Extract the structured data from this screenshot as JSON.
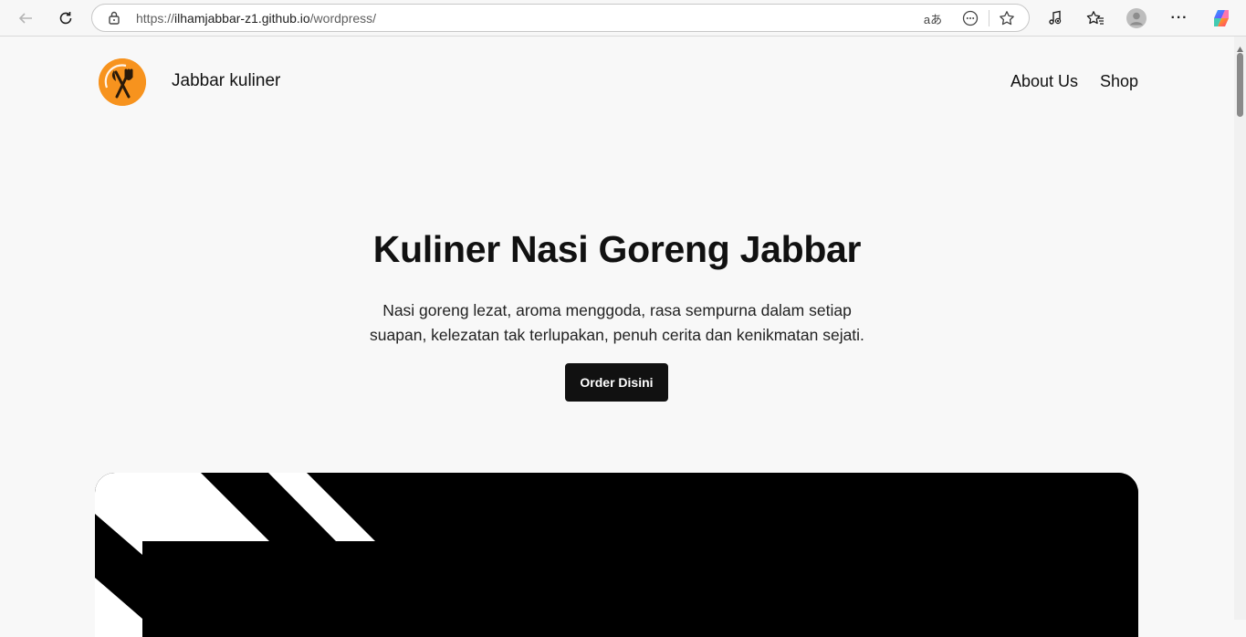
{
  "browser": {
    "url_scheme": "https://",
    "url_host": "ilhamjabbar-z1.github.io",
    "url_path": "/wordpress/",
    "icons": {
      "back": "back-arrow-icon",
      "reload": "reload-icon",
      "lock": "lock-icon",
      "read_aloud": "read-aloud-icon",
      "extension": "page-extension-icon",
      "favorite": "star-icon",
      "media": "media-control-icon",
      "favorites": "favorites-icon",
      "profile": "profile-avatar-icon",
      "menu": "more-menu-icon",
      "copilot": "copilot-icon"
    },
    "read_aloud_glyph": "aあ",
    "menu_glyph": "···"
  },
  "site": {
    "title": "Jabbar kuliner",
    "logo_color": "#f7931e"
  },
  "nav": {
    "items": [
      {
        "label": "About Us"
      },
      {
        "label": "Shop"
      }
    ]
  },
  "hero": {
    "title": "Kuliner Nasi Goreng Jabbar",
    "text": "Nasi goreng lezat, aroma menggoda, rasa sempurna dalam setiap suapan, kelezatan tak terlupakan, penuh cerita dan kenikmatan sejati.",
    "button_label": "Order Disini"
  },
  "colors": {
    "background": "#f8f8f8",
    "text": "#111111",
    "button": "#111111",
    "button_text": "#ffffff"
  }
}
